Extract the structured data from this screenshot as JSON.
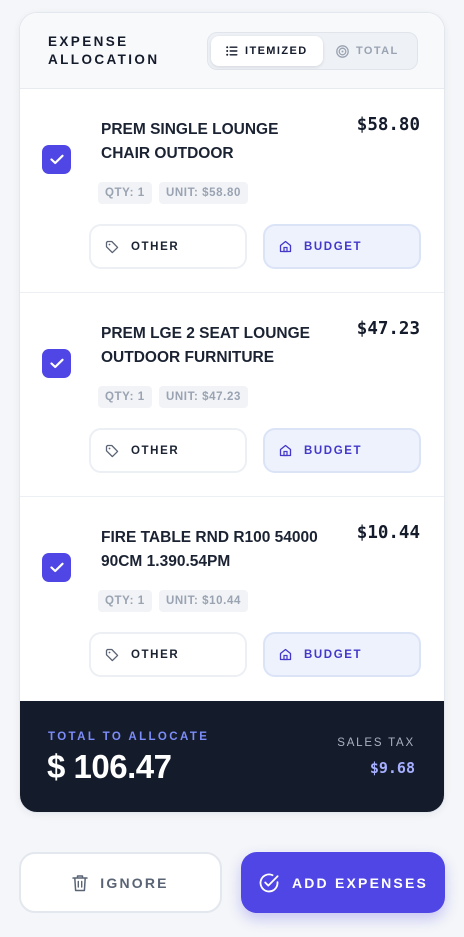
{
  "header": {
    "title": "EXPENSE ALLOCATION",
    "tabs": [
      {
        "label": "ITEMIZED",
        "icon": "list-icon",
        "active": true
      },
      {
        "label": "TOTAL",
        "icon": "target-icon",
        "active": false
      }
    ]
  },
  "items": [
    {
      "name": "PREM SINGLE LOUNGE CHAIR OUTDOOR",
      "price": "$58.80",
      "qty": "QTY: 1",
      "unit": "UNIT: $58.80",
      "checked": true,
      "other_label": "OTHER",
      "budget_label": "BUDGET"
    },
    {
      "name": "PREM LGE 2 SEAT LOUNGE OUTDOOR FURNITURE",
      "price": "$47.23",
      "qty": "QTY: 1",
      "unit": "UNIT: $47.23",
      "checked": true,
      "other_label": "OTHER",
      "budget_label": "BUDGET"
    },
    {
      "name": "FIRE TABLE RND R100 54000 90CM 1.390.54PM",
      "price": "$10.44",
      "qty": "QTY: 1",
      "unit": "UNIT: $10.44",
      "checked": true,
      "other_label": "OTHER",
      "budget_label": "BUDGET"
    }
  ],
  "summary": {
    "total_label": "TOTAL TO ALLOCATE",
    "total_value": "$ 106.47",
    "tax_label": "SALES TAX",
    "tax_value": "$9.68"
  },
  "actions": {
    "ignore_label": "IGNORE",
    "add_label": "ADD EXPENSES"
  },
  "colors": {
    "accent": "#4f46e5",
    "dark_panel": "#141b2b",
    "budget_bg": "#eef2fd"
  }
}
